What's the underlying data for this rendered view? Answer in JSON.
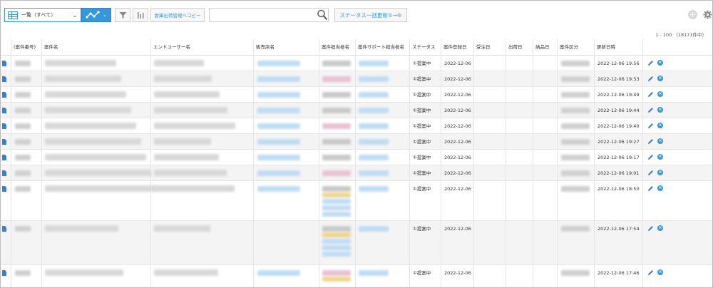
{
  "toolbar": {
    "view_label": "一覧（すべて）",
    "copy_label": "倉庫出荷管理へコピー",
    "search_placeholder": "",
    "status_label": "ステータス一括更新①→⑥",
    "plus_label": "+"
  },
  "pager": {
    "text": "1 - 100 （18171件中）"
  },
  "columns": [
    "(案件番号)",
    "案件名",
    "エンドユーザー名",
    "販売店名",
    "案件担当者名",
    "案件サポート担当者名",
    "ステータス",
    "案件登録日",
    "受注日",
    "出荷日",
    "納品日",
    "案件区分",
    "更新日時"
  ],
  "rows": [
    {
      "status": "①提案中",
      "registered": "2022-12-06",
      "updated": "2022-12-06 19:56"
    },
    {
      "status": "①提案中",
      "registered": "2022-12-06",
      "updated": "2022-12-06 19:53"
    },
    {
      "status": "①提案中",
      "registered": "2022-12-06",
      "updated": "2022-12-06 19:49"
    },
    {
      "status": "①提案中",
      "registered": "2022-12-06",
      "updated": "2022-12-06 19:44"
    },
    {
      "status": "①提案中",
      "registered": "2022-12-06",
      "updated": "2022-12-06 19:40"
    },
    {
      "status": "①提案中",
      "registered": "2022-12-06",
      "updated": "2022-12-06 19:27"
    },
    {
      "status": "①提案中",
      "registered": "2022-12-06",
      "updated": "2022-12-06 19:17"
    },
    {
      "status": "①提案中",
      "registered": "2022-12-06",
      "updated": "2022-12-06 19:01"
    },
    {
      "status": "①提案中",
      "registered": "2022-12-06",
      "updated": "2022-12-06 18:50"
    },
    {
      "status": "①提案中",
      "registered": "2022-12-06",
      "updated": "2022-12-06 17:54"
    },
    {
      "status": "①提案中",
      "registered": "2022-12-06",
      "updated": "2022-12-06 17:46"
    }
  ],
  "colors": {
    "accent": "#3498db",
    "icon_blue": "#3a7fd5"
  },
  "icons": [
    "table-icon",
    "line-graph-icon",
    "filter-icon",
    "bar-chart-icon",
    "search-icon",
    "plus-icon",
    "gear-icon",
    "doc-icon",
    "pencil-icon",
    "close-icon"
  ]
}
